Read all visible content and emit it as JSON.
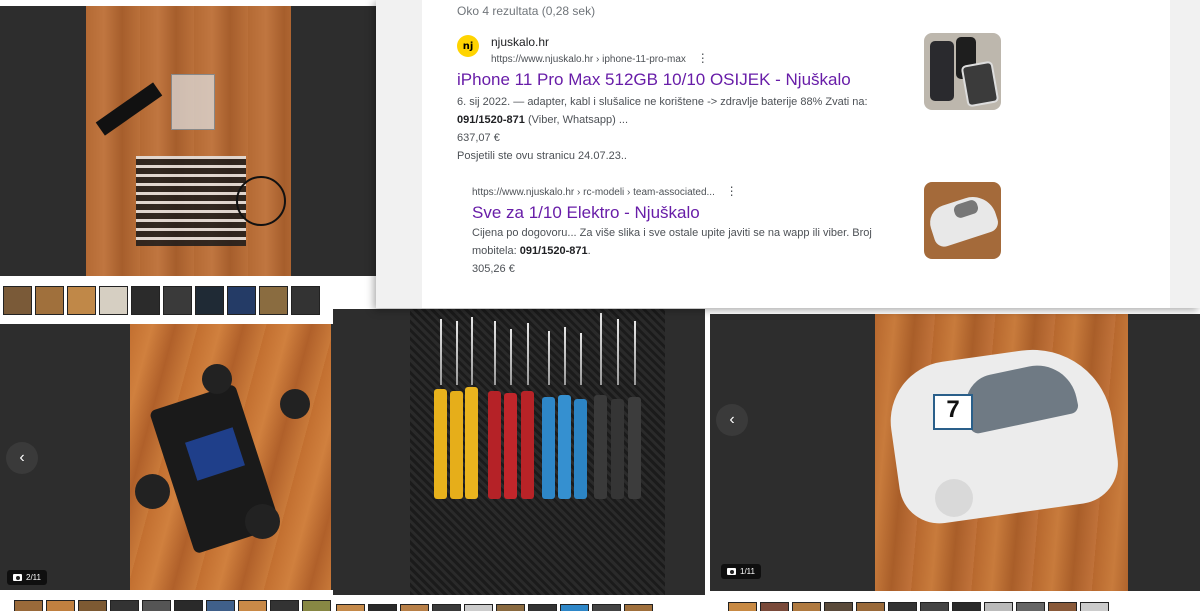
{
  "search": {
    "stats": "Oko 4 rezultata (0,28 sek)",
    "results": [
      {
        "favicon_text": "nj",
        "site_name": "njuskalo.hr",
        "url": "https://www.njuskalo.hr › iphone-11-pro-max",
        "menu_icon": "⋮",
        "title": "iPhone 11 Pro Max 512GB 10/10 OSIJEK - Njuškalo",
        "snippet_line1": "6. sij 2022. — adapter, kabl i slušalice ne korištene -> zdravlje baterije 88% Zvati na:",
        "snippet_bold": "091/1520-871",
        "snippet_line2_rest": " (Viber, Whatsapp) ...",
        "price": "637,07 €",
        "visited": "Posjetili ste ovu stranicu 24.07.23.."
      },
      {
        "url": "https://www.njuskalo.hr › rc-modeli › team-associated...",
        "menu_icon": "⋮",
        "title": "Sve za 1/10 Elektro - Njuškalo",
        "snippet_line1": "Cijena po dogovoru... Za više slika i sve ostale upite javiti se na wapp ili viber. Broj",
        "snippet_line2_prefix": "mobitela: ",
        "snippet_bold": "091/1520-871",
        "snippet_line2_suffix": ".",
        "price": "305,26 €"
      }
    ]
  },
  "galleries": {
    "chassis": {
      "counter": "2/11",
      "prev_icon": "‹"
    },
    "car_body": {
      "counter": "1/11",
      "prev_icon": "‹"
    }
  },
  "colors": {
    "link_visited": "#681da8",
    "gallery_bg": "#2d2d2d",
    "njuskalo_yellow": "#ffd400"
  }
}
